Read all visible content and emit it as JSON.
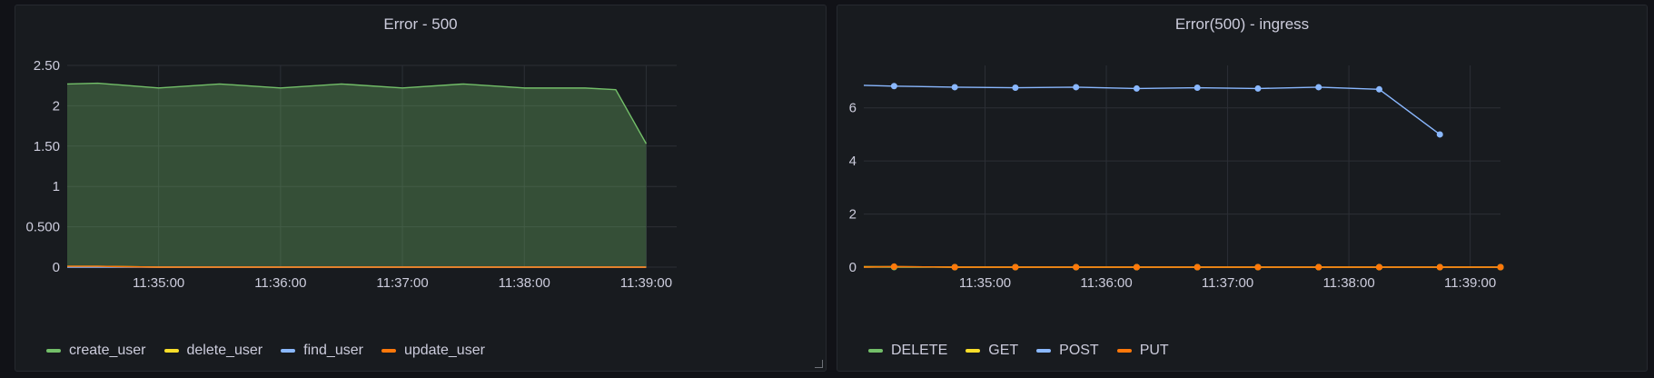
{
  "panels": [
    {
      "title": "Error - 500",
      "legend": [
        {
          "name": "create_user",
          "color": "#73bf69"
        },
        {
          "name": "delete_user",
          "color": "#fade2a"
        },
        {
          "name": "find_user",
          "color": "#8ab8ff"
        },
        {
          "name": "update_user",
          "color": "#ff780a"
        }
      ]
    },
    {
      "title": "Error(500) - ingress",
      "legend": [
        {
          "name": "DELETE",
          "color": "#73bf69"
        },
        {
          "name": "GET",
          "color": "#fade2a"
        },
        {
          "name": "POST",
          "color": "#8ab8ff"
        },
        {
          "name": "PUT",
          "color": "#ff780a"
        }
      ]
    }
  ],
  "chart_data": [
    {
      "type": "area",
      "title": "Error - 500",
      "xlabel": "",
      "ylabel": "",
      "x_ticks": [
        "11:35:00",
        "11:36:00",
        "11:37:00",
        "11:38:00",
        "11:39:00"
      ],
      "y_ticks": [
        "0",
        "0.500",
        "1",
        "1.50",
        "2",
        "2.50"
      ],
      "ylim": [
        0,
        2.5
      ],
      "xlim": [
        "11:34:15",
        "11:39:15"
      ],
      "grid": true,
      "legend_position": "bottom-left",
      "x": [
        "11:34:15",
        "11:34:30",
        "11:35:00",
        "11:35:30",
        "11:36:00",
        "11:36:30",
        "11:37:00",
        "11:37:30",
        "11:38:00",
        "11:38:30",
        "11:38:45",
        "11:39:00"
      ],
      "series": [
        {
          "name": "create_user",
          "color": "#73bf69",
          "fill": true,
          "values": [
            2.27,
            2.28,
            2.22,
            2.27,
            2.22,
            2.27,
            2.22,
            2.27,
            2.22,
            2.22,
            2.2,
            1.53
          ]
        },
        {
          "name": "delete_user",
          "color": "#fade2a",
          "values": [
            0.01,
            0.01,
            0,
            0,
            0,
            0,
            0,
            0,
            0,
            0,
            0,
            0
          ]
        },
        {
          "name": "find_user",
          "color": "#8ab8ff",
          "values": [
            0,
            0,
            0,
            0,
            0,
            0,
            0,
            0,
            0,
            0,
            0,
            0
          ]
        },
        {
          "name": "update_user",
          "color": "#ff780a",
          "values": [
            0.01,
            0.01,
            0,
            0,
            0,
            0,
            0,
            0,
            0,
            0,
            0,
            0
          ]
        }
      ]
    },
    {
      "type": "line",
      "title": "Error(500) - ingress",
      "xlabel": "",
      "ylabel": "",
      "x_ticks": [
        "11:35:00",
        "11:36:00",
        "11:37:00",
        "11:38:00",
        "11:39:00"
      ],
      "y_ticks": [
        "0",
        "2",
        "4",
        "6"
      ],
      "ylim": [
        0,
        7.6
      ],
      "xlim": [
        "11:34:00",
        "11:39:15"
      ],
      "grid": true,
      "legend_position": "bottom-left",
      "x": [
        "11:34:00",
        "11:34:15",
        "11:34:45",
        "11:35:15",
        "11:35:45",
        "11:36:15",
        "11:36:45",
        "11:37:15",
        "11:37:45",
        "11:38:15",
        "11:38:45",
        "11:39:15"
      ],
      "points_from_index": 1,
      "series": [
        {
          "name": "DELETE",
          "color": "#73bf69",
          "values": [
            0,
            0,
            0,
            0,
            0,
            0,
            0,
            0,
            0,
            0,
            0,
            0
          ]
        },
        {
          "name": "GET",
          "color": "#fade2a",
          "values": [
            0.02,
            0.02,
            0,
            0,
            0,
            0,
            0,
            0,
            0,
            0,
            0,
            0
          ]
        },
        {
          "name": "POST",
          "color": "#8ab8ff",
          "values": [
            6.85,
            6.82,
            6.78,
            6.76,
            6.78,
            6.73,
            6.76,
            6.73,
            6.78,
            6.7,
            5.0,
            null
          ]
        },
        {
          "name": "PUT",
          "color": "#ff780a",
          "values": [
            0,
            0.02,
            0,
            0,
            0,
            0,
            0,
            0,
            0,
            0,
            0,
            0
          ]
        }
      ]
    }
  ]
}
